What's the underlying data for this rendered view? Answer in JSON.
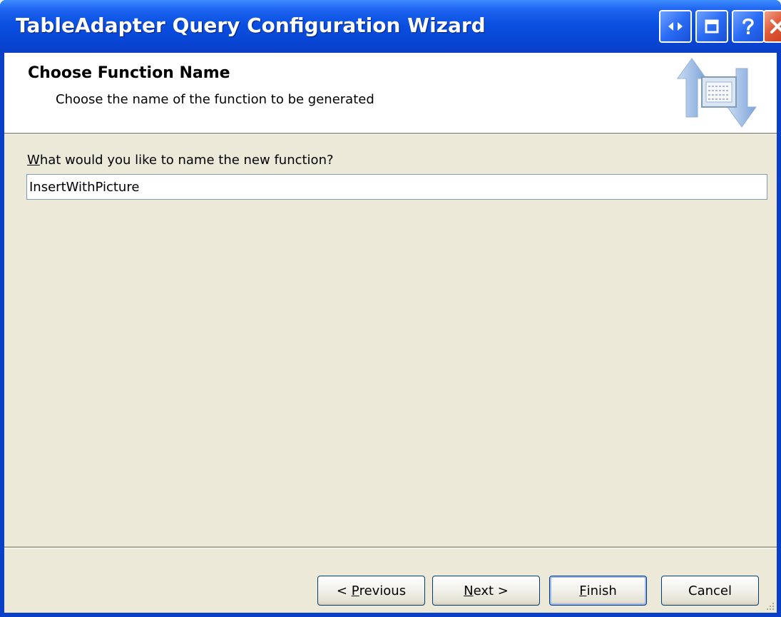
{
  "window": {
    "title": "TableAdapter Query Configuration Wizard",
    "controls": [
      "resize-icon",
      "restore-icon",
      "help-icon",
      "close-icon"
    ]
  },
  "header": {
    "title": "Choose Function Name",
    "subtitle": "Choose the name of the function to be generated",
    "graphic": "data-transfer-arrows-icon"
  },
  "form": {
    "label_mnemonic": "W",
    "label_rest": "hat would you like to name the new function?",
    "function_name": "InsertWithPicture"
  },
  "buttons": {
    "previous": {
      "prefix": "< ",
      "mnemonic": "P",
      "rest": "revious"
    },
    "next": {
      "mnemonic": "N",
      "rest": "ext >"
    },
    "finish": {
      "mnemonic": "F",
      "rest": "inish"
    },
    "cancel": {
      "label": "Cancel"
    }
  },
  "colors": {
    "titlebar": "#0a50e2",
    "client": "#ece9d8",
    "close_button": "#e05a36"
  }
}
